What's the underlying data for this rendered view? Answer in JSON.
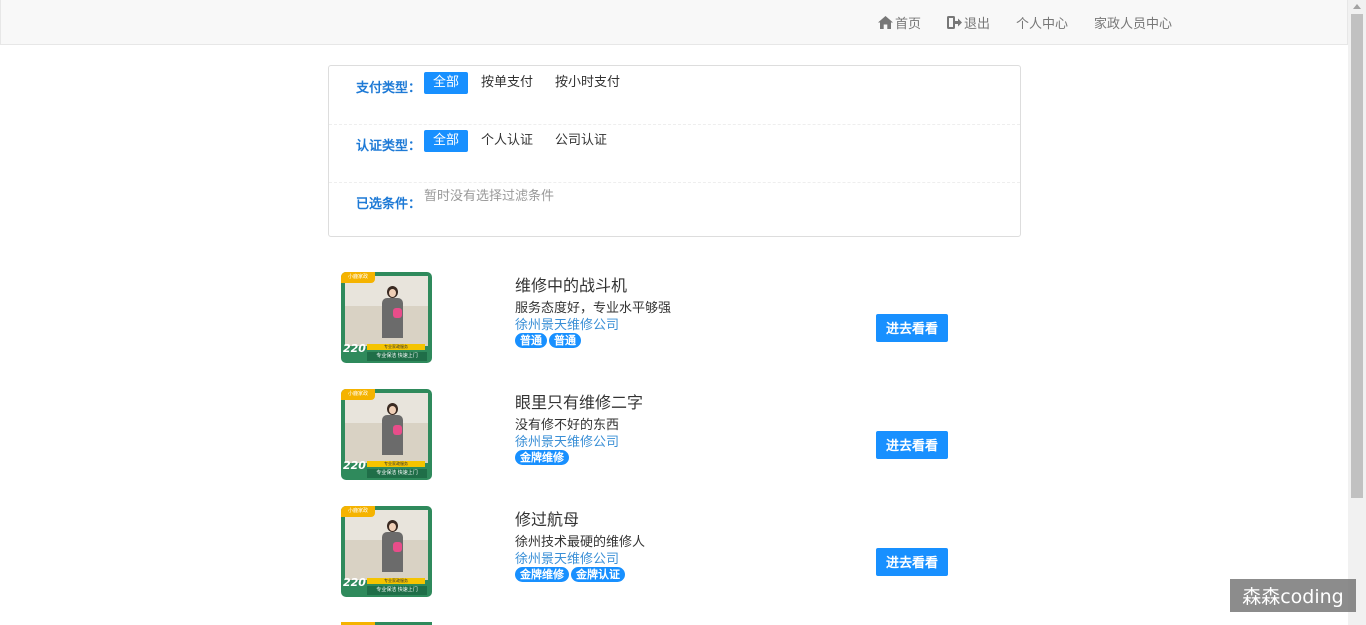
{
  "nav": {
    "home": "首页",
    "logout": "退出",
    "personal_center": "个人中心",
    "staff_center": "家政人员中心"
  },
  "filters": {
    "payment": {
      "label": "支付类型：",
      "options": [
        "全部",
        "按单支付",
        "按小时支付"
      ],
      "selected": "全部"
    },
    "certification": {
      "label": "认证类型：",
      "options": [
        "全部",
        "个人认证",
        "公司认证"
      ],
      "selected": "全部"
    },
    "selected_conditions": {
      "label": "已选条件：",
      "value": "暂时没有选择过滤条件"
    }
  },
  "items": [
    {
      "title": "维修中的战斗机",
      "desc": "服务态度好，专业水平够强",
      "company": "徐州景天维修公司",
      "tags": [
        "普通",
        "普通"
      ],
      "button": "进去看看",
      "thumb": {
        "badge": "小鹿家政",
        "price": "220",
        "strip": "专业家政服务",
        "foot": "专业保洁 快速上门"
      }
    },
    {
      "title": "眼里只有维修二字",
      "desc": "没有修不好的东西",
      "company": "徐州景天维修公司",
      "tags": [
        "金牌维修"
      ],
      "button": "进去看看",
      "thumb": {
        "badge": "小鹿家政",
        "price": "220",
        "strip": "专业家政服务",
        "foot": "专业保洁 快速上门"
      }
    },
    {
      "title": "修过航母",
      "desc": "徐州技术最硬的维修人",
      "company": "徐州景天维修公司",
      "tags": [
        "金牌维修",
        "金牌认证"
      ],
      "button": "进去看看",
      "thumb": {
        "badge": "小鹿家政",
        "price": "220",
        "strip": "专业家政服务",
        "foot": "专业保洁 快速上门"
      }
    }
  ],
  "watermark": "森森coding",
  "colors": {
    "accent": "#1890ff",
    "label_blue": "#1e7ad6",
    "company_blue": "#3a8fd6"
  }
}
